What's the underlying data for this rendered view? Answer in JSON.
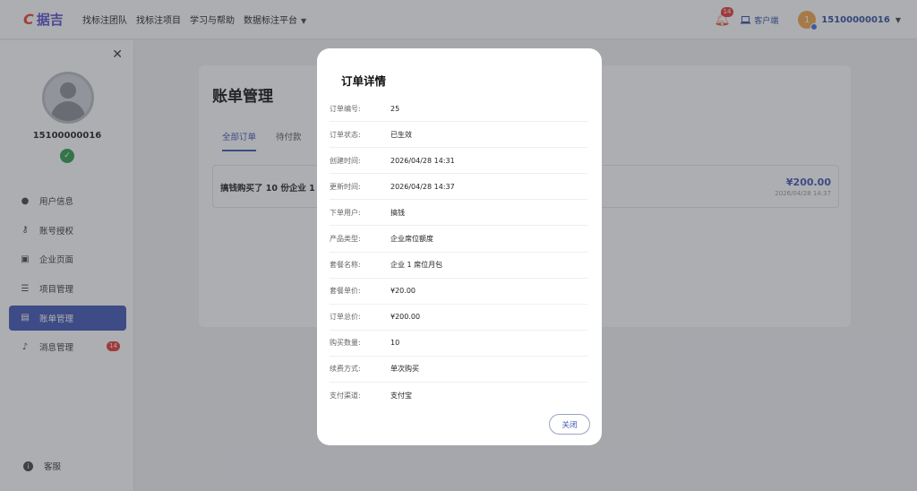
{
  "header": {
    "logo_mark": "C",
    "logo_text": "据吉",
    "nav": [
      "找标注团队",
      "找标注项目",
      "学习与帮助",
      "数据标注平台"
    ],
    "notification_count": "14",
    "client_label": "客户端",
    "avatar_initial": "1",
    "username": "15100000016"
  },
  "sidebar": {
    "username": "15100000016",
    "items": [
      {
        "label": "用户信息",
        "icon": "user-icon"
      },
      {
        "label": "账号授权",
        "icon": "key-icon"
      },
      {
        "label": "企业页面",
        "icon": "store-icon"
      },
      {
        "label": "项目管理",
        "icon": "list-icon"
      },
      {
        "label": "账单管理",
        "icon": "document-icon",
        "active": true
      },
      {
        "label": "消息管理",
        "icon": "bell-icon",
        "badge": "14"
      }
    ],
    "service_label": "客服"
  },
  "main": {
    "title": "账单管理",
    "tabs": [
      "全部订单",
      "待付款"
    ],
    "order": {
      "title": "搞钱购买了 10 份企业 1 席",
      "amount": "¥200.00",
      "time": "2026/04/28 14:37"
    }
  },
  "modal": {
    "title": "订单详情",
    "rows": [
      {
        "label": "订单编号:",
        "value": "25"
      },
      {
        "label": "订单状态:",
        "value": "已生效"
      },
      {
        "label": "创建时间:",
        "value": "2026/04/28 14:31"
      },
      {
        "label": "更新时间:",
        "value": "2026/04/28 14:37"
      },
      {
        "label": "下单用户:",
        "value": "搞钱"
      },
      {
        "label": "产品类型:",
        "value": "企业席位额度"
      },
      {
        "label": "套餐名称:",
        "value": "企业 1 席位月包"
      },
      {
        "label": "套餐单价:",
        "value": "¥20.00"
      },
      {
        "label": "订单总价:",
        "value": "¥200.00"
      },
      {
        "label": "购买数量:",
        "value": "10"
      },
      {
        "label": "续费方式:",
        "value": "单次购买"
      },
      {
        "label": "支付渠道:",
        "value": "支付宝"
      }
    ],
    "close_label": "关闭"
  },
  "colors": {
    "accent": "#3f55b5",
    "badge": "#e53935",
    "verified": "#2e9d4d"
  }
}
